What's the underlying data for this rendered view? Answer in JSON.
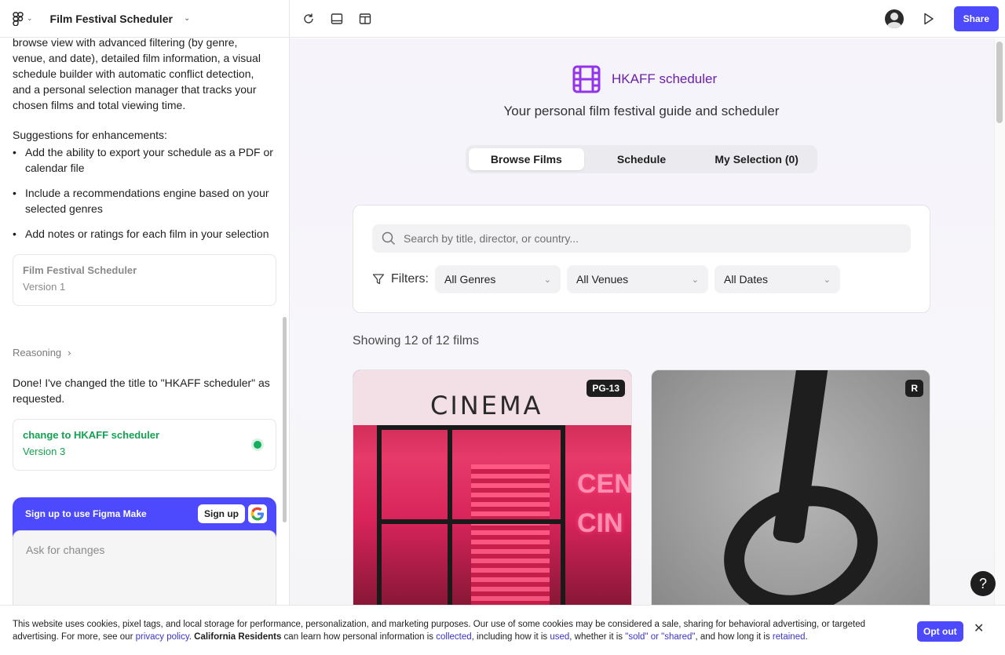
{
  "app": {
    "project_title": "Film Festival Scheduler"
  },
  "chat": {
    "intro_text": "browse view with advanced filtering (by genre, venue, and date), detailed film information, a visual schedule builder with automatic conflict detection, and a personal selection manager that tracks your chosen films and total viewing time.",
    "suggestions_title": "Suggestions for enhancements:",
    "suggestions": [
      "Add the ability to export your schedule as a PDF or calendar file",
      "Include a recommendations engine based on your selected genres",
      "Add notes or ratings for each film in your selection"
    ],
    "version_card_1": {
      "title": "Film Festival Scheduler",
      "version": "Version 1"
    },
    "reasoning_label": "Reasoning",
    "done_message": "Done! I've changed the title to \"HKAFF scheduler\" as requested.",
    "version_card_2": {
      "title": "change to HKAFF scheduler",
      "version": "Version 3"
    },
    "signup_prompt": "Sign up to use Figma Make",
    "signup_button": "Sign up",
    "ask_placeholder": "Ask for changes"
  },
  "toolbar": {
    "share_label": "Share"
  },
  "preview": {
    "brand_title": "HKAFF scheduler",
    "subtitle": "Your personal film festival guide and scheduler",
    "tabs": [
      {
        "label": "Browse Films",
        "active": true
      },
      {
        "label": "Schedule",
        "active": false
      },
      {
        "label": "My Selection (0)",
        "active": false
      }
    ],
    "search_placeholder": "Search by title, director, or country...",
    "filters_label": "Filters:",
    "genre_select": "All Genres",
    "venue_select": "All Venues",
    "date_select": "All Dates",
    "showing_text": "Showing 12 of 12 films",
    "films": [
      {
        "rating": "PG-13",
        "image_text": "CINEMA"
      },
      {
        "rating": "R"
      }
    ],
    "help_label": "?"
  },
  "cookie": {
    "text_1": "This website uses cookies, pixel tags, and local storage for performance, personalization, and marketing purposes. Our use of some cookies may be considered a sale, sharing for behavioral advertising, or targeted advertising. For more, see our ",
    "privacy_link": "privacy policy",
    "text_2": ". ",
    "ca_bold": "California Residents",
    "text_3": " can learn how personal information is ",
    "collected_link": "collected",
    "text_4": ", including how it is ",
    "used_link": "used",
    "text_5": ", whether it is ",
    "sold_link": "\"sold\" or \"shared\"",
    "text_6": ", and how long it is ",
    "retained_link": "retained",
    "text_7": ".",
    "optout_label": "Opt out"
  },
  "colors": {
    "accent": "#4d49fc",
    "brand_purple": "#6b21a8",
    "success_green": "#14a150"
  }
}
